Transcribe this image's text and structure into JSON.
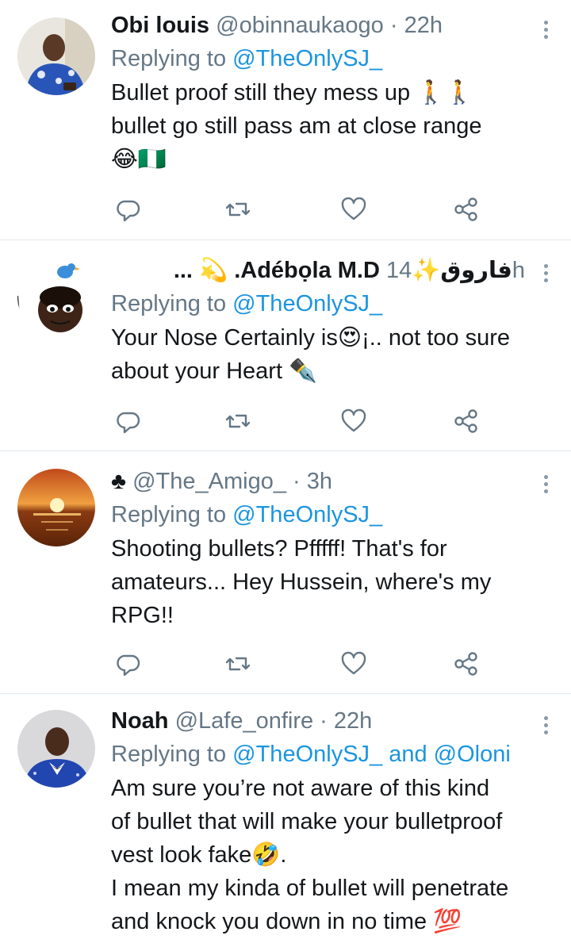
{
  "tweets": [
    {
      "name": "Obi louis",
      "handle": "@obinnaukaogo",
      "sep": " · ",
      "time": "22h",
      "replying_prefix": "Replying to ",
      "replying_to": "@TheOnlySJ_",
      "text_lines": [
        "Bullet proof still they mess up 🚶🚶",
        "bullet go still pass am at close range",
        "😂🇳🇬"
      ]
    },
    {
      "name_prefix": "... 💫 ",
      "name": ".Adébọla M.D فاروق",
      "name_suffix": "✨",
      "time": "14h",
      "replying_prefix": "Replying to ",
      "replying_to": "@TheOnlySJ_",
      "text_lines": [
        "Your Nose Certainly is😍¡.. not too sure",
        "about your Heart ✒️"
      ]
    },
    {
      "name": "♣",
      "handle": "@The_Amigo_",
      "sep": " · ",
      "time": "3h",
      "replying_prefix": "Replying to ",
      "replying_to": "@TheOnlySJ_",
      "text_lines": [
        "Shooting bullets? Pfffff! That's for",
        "amateurs... Hey Hussein, where's my",
        "RPG!!"
      ]
    },
    {
      "name": "Noah",
      "handle": "@Lafe_onfire",
      "sep": " · ",
      "time": "22h",
      "replying_prefix": "Replying to ",
      "replying_to": "@TheOnlySJ_",
      "replying_and": " and ",
      "replying_to_2": "@Oloni",
      "text_lines": [
        "Am sure you’re not aware of this kind",
        "of bullet that will make your bulletproof",
        "vest look fake🤣.",
        "I mean my kinda of bullet will penetrate",
        "and knock you down in no time 💯"
      ]
    }
  ],
  "icons": {
    "reply": "reply-icon",
    "retweet": "retweet-icon",
    "like": "heart-icon",
    "share": "share-icon",
    "menu": "more-options-icon"
  },
  "colors": {
    "link": "#1b95e0",
    "secondary": "#657786",
    "divider": "#e1e8ed"
  }
}
